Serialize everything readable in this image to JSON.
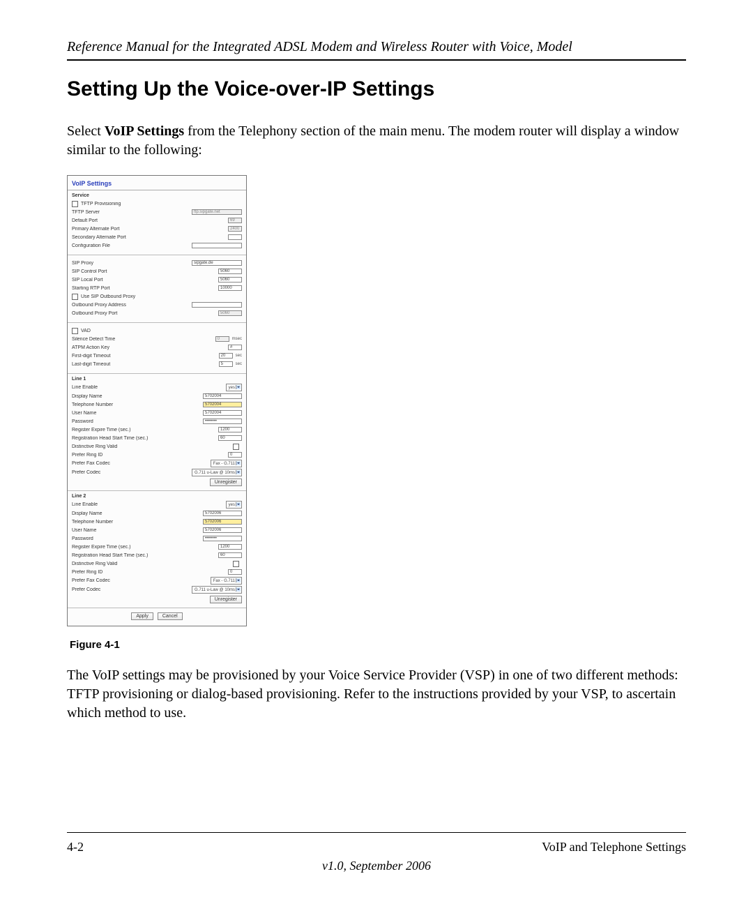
{
  "header": "Reference Manual for the Integrated ADSL Modem and Wireless Router with Voice, Model",
  "section_title": "Setting Up the Voice-over-IP Settings",
  "intro_prefix": "Select ",
  "intro_bold": "VoIP Settings",
  "intro_suffix": " from the Telephony section of the main menu. The modem router will display a window similar to the following:",
  "figure_label": "Figure 4-1",
  "after_figure": "The VoIP settings may be provisioned by your Voice Service Provider (VSP) in one of two different methods: TFTP provisioning or dialog-based provisioning. Refer to the instructions provided by your VSP, to ascertain which method to use.",
  "footer": {
    "page_num": "4-2",
    "chapter": "VoIP and Telephone Settings",
    "version": "v1.0, September 2006"
  },
  "panel": {
    "title": "VoIP Settings",
    "service": {
      "heading": "Service",
      "tftp_provisioning": "TFTP Provisioning",
      "tftp_server_label": "TFTP Server",
      "tftp_server_value": "ftp.sipgate.net",
      "default_port_label": "Default Port",
      "default_port_value": "69",
      "primary_alt_label": "Primary Alternate Port",
      "primary_alt_value": "2400",
      "secondary_alt_label": "Secondary Alternate Port",
      "secondary_alt_value": "",
      "config_file_label": "Configuration File",
      "config_file_value": ""
    },
    "sip": {
      "sip_proxy_label": "SIP Proxy",
      "sip_proxy_value": "sipgate.de",
      "sip_control_port_label": "SIP Control Port",
      "sip_control_port_value": "5060",
      "sip_local_port_label": "SIP Local Port",
      "sip_local_port_value": "5060",
      "starting_rtp_label": "Starting RTP Port",
      "starting_rtp_value": "10000",
      "use_outbound_label": "Use SIP Outbound Proxy",
      "outbound_addr_label": "Outbound Proxy Address",
      "outbound_addr_value": "",
      "outbound_port_label": "Outbound Proxy Port",
      "outbound_port_value": "5060"
    },
    "vad": {
      "vad_label": "VAD",
      "silence_label": "Silence Detect Time",
      "silence_value": "0",
      "silence_unit": "msec",
      "atpm_label": "ATPM Action Key",
      "atpm_value": "#",
      "first_digit_label": "First-digit Timeout",
      "first_digit_value": "20",
      "first_digit_unit": "sec",
      "last_digit_label": "Last-digit Timeout",
      "last_digit_value": "5",
      "last_digit_unit": "sec"
    },
    "line1": {
      "heading": "Line 1",
      "enable_label": "Line Enable",
      "enable_value": "yes",
      "display_name_label": "Display Name",
      "display_name_value": "5702004",
      "telephone_label": "Telephone Number",
      "telephone_value": "5702004",
      "user_label": "User Name",
      "user_value": "5702004",
      "password_label": "Password",
      "password_value": "••••••••",
      "reg_expire_label": "Register Expire Time (sec.)",
      "reg_expire_value": "1200",
      "reg_head_label": "Registration Head Start Time (sec.)",
      "reg_head_value": "60",
      "dist_ring_valid_label": "Distinctive Ring Valid",
      "prefer_ring_label": "Prefer Ring ID",
      "prefer_ring_value": "0",
      "prefer_fax_label": "Prefer Fax Codec",
      "prefer_fax_value": "Fax - G.711",
      "prefer_codec_label": "Prefer Codec",
      "prefer_codec_value": "G.711 u-Law @ 10ms",
      "unregister": "Unregister"
    },
    "line2": {
      "heading": "Line 2",
      "enable_label": "Line Enable",
      "enable_value": "yes",
      "display_name_label": "Display Name",
      "display_name_value": "5702006",
      "telephone_label": "Telephone Number",
      "telephone_value": "5702006",
      "user_label": "User Name",
      "user_value": "5702006",
      "password_label": "Password",
      "password_value": "••••••••",
      "reg_expire_label": "Register Expire Time (sec.)",
      "reg_expire_value": "1200",
      "reg_head_label": "Registration Head Start Time (sec.)",
      "reg_head_value": "60",
      "dist_ring_valid_label": "Distinctive Ring Valid",
      "prefer_ring_label": "Prefer Ring ID",
      "prefer_ring_value": "0",
      "prefer_fax_label": "Prefer Fax Codec",
      "prefer_fax_value": "Fax - G.711",
      "prefer_codec_label": "Prefer Codec",
      "prefer_codec_value": "G.711 u-Law @ 10ms",
      "unregister": "Unregister"
    },
    "buttons": {
      "apply": "Apply",
      "cancel": "Cancel"
    }
  }
}
